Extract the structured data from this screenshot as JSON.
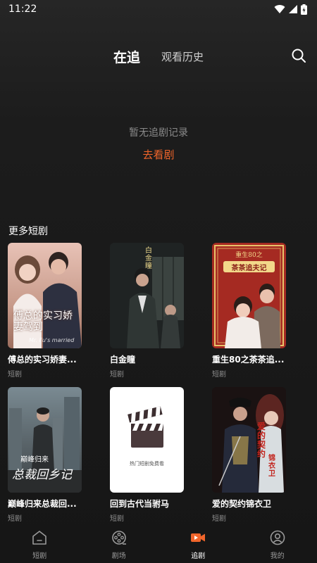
{
  "status": {
    "time": "11:22"
  },
  "header": {
    "tabs": [
      {
        "label": "在追",
        "active": true
      },
      {
        "label": "观看历史",
        "active": false
      }
    ]
  },
  "empty": {
    "message": "暂无追剧记录",
    "action": "去看剧"
  },
  "section": {
    "title": "更多短剧"
  },
  "dramas": [
    {
      "title": "傅总的实习娇妻...",
      "tag": "短剧",
      "cover_text": "傅总的实习娇妻驾到",
      "cover_sub": "Mr. Fu's married"
    },
    {
      "title": "白金瞳",
      "tag": "短剧",
      "cover_text": "白金瞳"
    },
    {
      "title": "重生80之茶茶追...",
      "tag": "短剧",
      "cover_text": "重生80之",
      "cover_text2": "茶茶追夫记"
    },
    {
      "title": "巅峰归来总裁回...",
      "tag": "短剧",
      "cover_text": "巅峰归来",
      "cover_text2": "总裁回乡记"
    },
    {
      "title": "回到古代当驸马",
      "tag": "短剧",
      "cover_text": "热门短剧免费看"
    },
    {
      "title": "爱的契约锦衣卫",
      "tag": "短剧",
      "cover_text": "爱的契约",
      "cover_text2": "锦衣卫"
    }
  ],
  "nav": [
    {
      "label": "短剧",
      "icon": "home-icon",
      "active": false
    },
    {
      "label": "剧场",
      "icon": "film-reel-icon",
      "active": false
    },
    {
      "label": "追剧",
      "icon": "video-camera-icon",
      "active": true
    },
    {
      "label": "我的",
      "icon": "user-icon",
      "active": false
    }
  ],
  "colors": {
    "accent": "#f0652b",
    "background": "#161616"
  }
}
